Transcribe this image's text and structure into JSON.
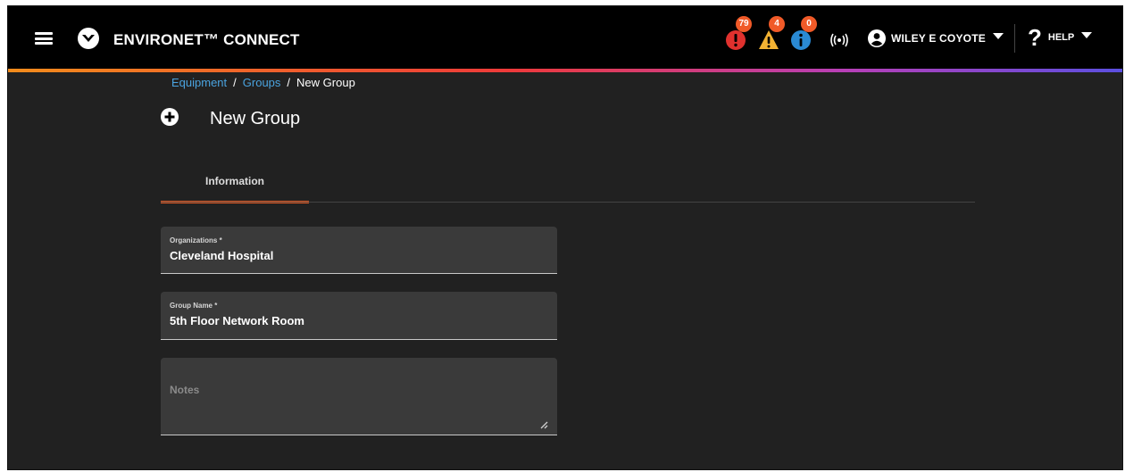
{
  "app": {
    "brand": "ENVIRONET™ CONNECT"
  },
  "header": {
    "alerts": [
      {
        "type": "critical",
        "count": "79",
        "color": "#e0312e"
      },
      {
        "type": "warning",
        "count": "4",
        "color": "#f2b233"
      },
      {
        "type": "info",
        "count": "0",
        "color": "#2a8ad4"
      }
    ],
    "user_name": "WILEY E COYOTE",
    "help_label": "HELP"
  },
  "breadcrumb": {
    "items": [
      "Equipment",
      "Groups"
    ],
    "current": "New Group"
  },
  "page": {
    "title": "New Group"
  },
  "tabs": [
    {
      "label": "Information",
      "active": true
    }
  ],
  "form": {
    "organization": {
      "label": "Organizations *",
      "value": "Cleveland Hospital"
    },
    "group_name": {
      "label": "Group Name *",
      "value": "5th Floor Network Room"
    },
    "notes": {
      "placeholder": "Notes",
      "value": ""
    }
  },
  "colors": {
    "accent": "#e85a22",
    "link": "#4aa3df",
    "background": "#212121"
  }
}
